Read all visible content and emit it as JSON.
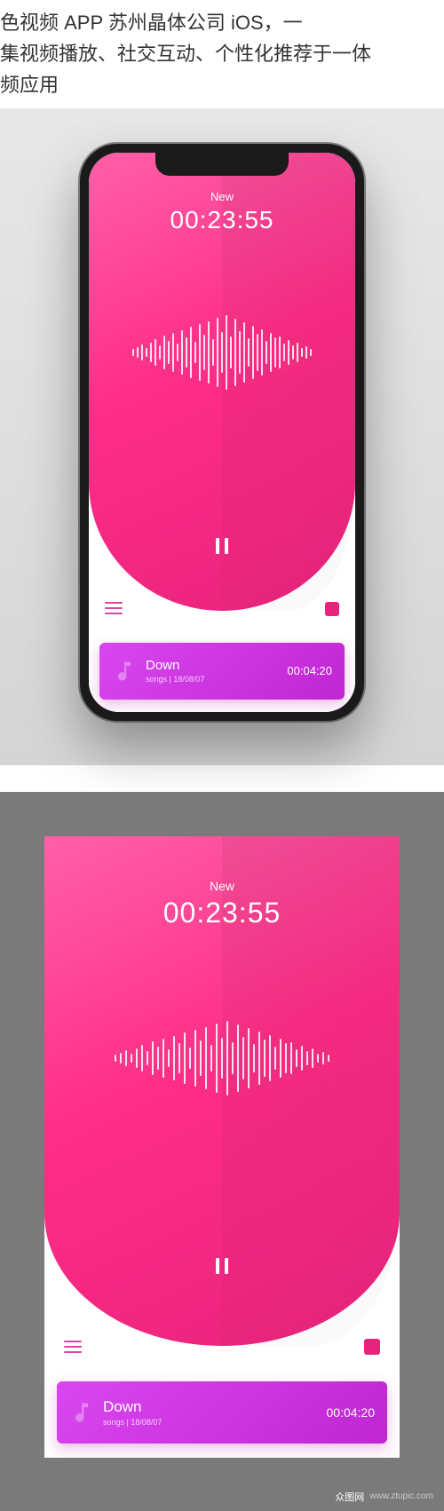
{
  "header": {
    "line1": "色视频 APP 苏州晶体公司 iOS，一",
    "line2": "集视频播放、社交互动、个性化推荐于一体",
    "line3": "频应用"
  },
  "player": {
    "track_label": "New",
    "timer": "00:23:55"
  },
  "now_playing": {
    "title": "Down",
    "artist": "songs",
    "date": "18/08/07",
    "time": "00:04:20"
  },
  "watermark": {
    "brand": "众图网",
    "url": "www.ztupic.com"
  },
  "waveform_heights": [
    8,
    12,
    18,
    10,
    22,
    30,
    16,
    38,
    26,
    44,
    20,
    50,
    34,
    58,
    24,
    64,
    40,
    70,
    30,
    78,
    46,
    84,
    36,
    76,
    48,
    68,
    32,
    60,
    42,
    52,
    26,
    44,
    34,
    36,
    20,
    28,
    16,
    22,
    10,
    14,
    8
  ]
}
